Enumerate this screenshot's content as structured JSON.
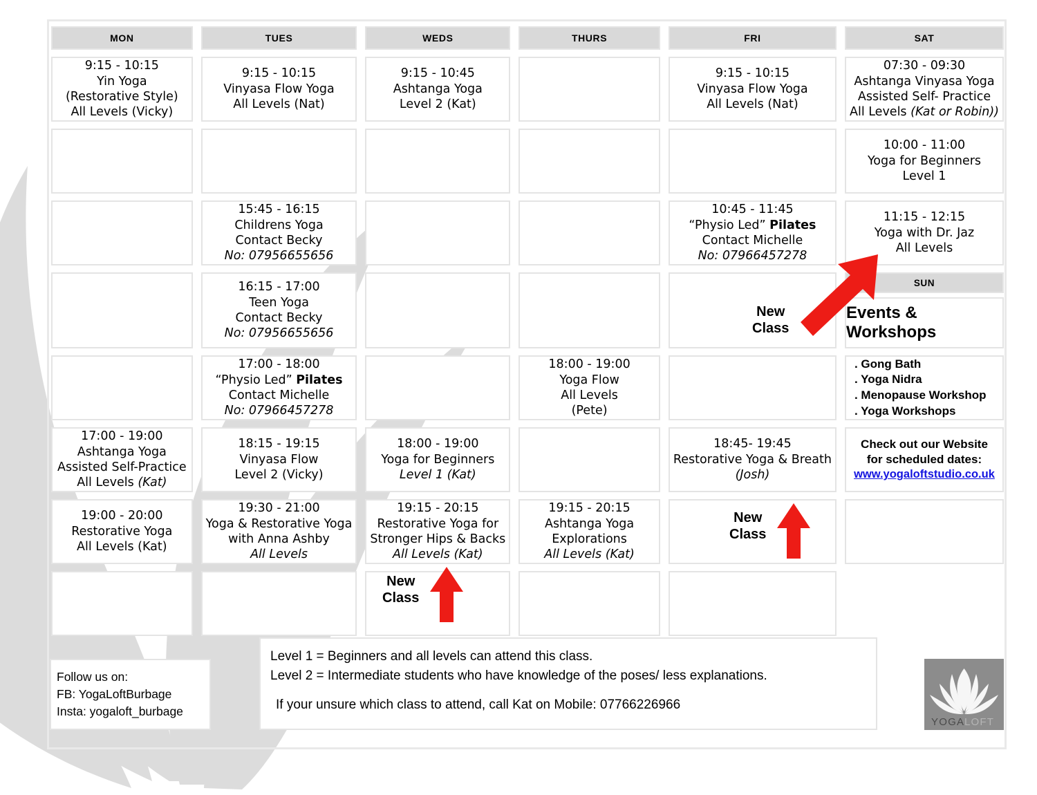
{
  "columns": [
    {
      "day": "MON",
      "cells": [
        {
          "lines": [
            {
              "t": "9:15 - 10:15"
            },
            {
              "t": "Yin Yoga"
            },
            {
              "t": "(Restorative Style)"
            },
            {
              "t": "All Levels (Vicky)"
            }
          ]
        },
        {
          "lines": []
        },
        {
          "lines": []
        },
        {
          "lines": []
        },
        {
          "lines": []
        },
        {
          "lines": [
            {
              "t": "17:00 - 19:00"
            },
            {
              "t": "Ashtanga Yoga"
            },
            {
              "t": "Assisted Self-Practice"
            },
            {
              "t": "All Levels "
            },
            {
              "t": "(Kat)",
              "style": "italic",
              "inline": true
            }
          ]
        },
        {
          "lines": [
            {
              "t": "19:00 - 20:00"
            },
            {
              "t": "Restorative Yoga"
            },
            {
              "t": "All Levels (Kat)"
            }
          ]
        },
        {
          "lines": []
        }
      ]
    },
    {
      "day": "TUES",
      "cells": [
        {
          "lines": [
            {
              "t": "9:15 - 10:15"
            },
            {
              "t": "Vinyasa Flow Yoga"
            },
            {
              "t": "All Levels (Nat)"
            }
          ]
        },
        {
          "lines": []
        },
        {
          "lines": [
            {
              "t": "15:45 - 16:15"
            },
            {
              "t": "Childrens Yoga"
            },
            {
              "t": "Contact Becky"
            },
            {
              "t": "No: 07956655656",
              "style": "italic"
            }
          ]
        },
        {
          "lines": [
            {
              "t": "16:15 - 17:00"
            },
            {
              "t": "Teen Yoga"
            },
            {
              "t": "Contact Becky"
            },
            {
              "t": "No: 07956655656",
              "style": "italic"
            }
          ]
        },
        {
          "lines": [
            {
              "t": "17:00 - 18:00"
            },
            {
              "t": "“Physio Led” ",
              "bold_tail": "Pilates"
            },
            {
              "t": "Contact Michelle"
            },
            {
              "t": "No: 07966457278",
              "style": "italic"
            }
          ]
        },
        {
          "lines": [
            {
              "t": "18:15 - 19:15"
            },
            {
              "t": "Vinyasa Flow"
            },
            {
              "t": "Level 2 (Vicky)"
            }
          ]
        },
        {
          "lines": [
            {
              "t": "19:30 - 21:00"
            },
            {
              "t": "Yoga & Restorative Yoga"
            },
            {
              "t": "with Anna Ashby"
            },
            {
              "t": "All Levels",
              "style": "italic"
            }
          ]
        },
        {
          "lines": []
        }
      ]
    },
    {
      "day": "WEDS",
      "cells": [
        {
          "lines": [
            {
              "t": "9:15 - 10:45"
            },
            {
              "t": "Ashtanga Yoga"
            },
            {
              "t": "Level 2 (Kat)"
            }
          ]
        },
        {
          "lines": []
        },
        {
          "lines": []
        },
        {
          "lines": []
        },
        {
          "lines": []
        },
        {
          "lines": [
            {
              "t": "18:00 - 19:00"
            },
            {
              "t": "Yoga for Beginners"
            },
            {
              "t": "Level 1 (Kat)",
              "style": "italic"
            }
          ]
        },
        {
          "lines": [
            {
              "t": "19:15 - 20:15"
            },
            {
              "t": "Restorative Yoga for"
            },
            {
              "t": "Stronger Hips & Backs"
            },
            {
              "t": "All Levels (Kat)",
              "style": "italic"
            }
          ]
        },
        {
          "lines": []
        }
      ]
    },
    {
      "day": "THURS",
      "cells": [
        {
          "lines": []
        },
        {
          "lines": []
        },
        {
          "lines": []
        },
        {
          "lines": []
        },
        {
          "lines": [
            {
              "t": "18:00 - 19:00"
            },
            {
              "t": "Yoga Flow"
            },
            {
              "t": "All Levels"
            },
            {
              "t": "(Pete)"
            }
          ]
        },
        {
          "lines": []
        },
        {
          "lines": [
            {
              "t": "19:15 - 20:15"
            },
            {
              "t": "Ashtanga Yoga"
            },
            {
              "t": "Explorations"
            },
            {
              "t": "All Levels (Kat)",
              "style": "italic"
            }
          ]
        },
        {
          "lines": []
        }
      ]
    },
    {
      "day": "FRI",
      "cells": [
        {
          "lines": [
            {
              "t": "9:15 - 10:15"
            },
            {
              "t": "Vinyasa Flow Yoga"
            },
            {
              "t": "All Levels (Nat)"
            }
          ]
        },
        {
          "lines": []
        },
        {
          "lines": [
            {
              "t": "10:45 - 11:45"
            },
            {
              "t": "“Physio Led” ",
              "bold_tail": "Pilates"
            },
            {
              "t": "Contact Michelle"
            },
            {
              "t": "No: 07966457278",
              "style": "italic"
            }
          ]
        },
        {
          "lines": []
        },
        {
          "lines": []
        },
        {
          "lines": [
            {
              "t": "18:45- 19:45"
            },
            {
              "t": "Restorative Yoga & Breath"
            },
            {
              "t": "(Josh)",
              "style": "italic"
            }
          ]
        },
        {
          "lines": []
        },
        {
          "lines": []
        }
      ]
    },
    {
      "day": "SAT",
      "cells": [
        {
          "lines": [
            {
              "t": "07:30 - 09:30"
            },
            {
              "t": "Ashtanga Vinyasa Yoga"
            },
            {
              "t": "Assisted Self- Practice"
            },
            {
              "t": "All Levels ",
              "italic_tail": "(Kat or Robin))"
            }
          ]
        },
        {
          "lines": [
            {
              "t": "10:00 - 11:00"
            },
            {
              "t": "Yoga for Beginners"
            },
            {
              "t": "Level 1"
            }
          ]
        },
        {
          "lines": [
            {
              "t": "11:15 - 12:15"
            },
            {
              "t": "Yoga with Dr. Jaz"
            },
            {
              "t": "All Levels"
            }
          ]
        }
      ]
    }
  ],
  "sunday": {
    "header": "SUN",
    "events_title": "Events & Workshops",
    "events": [
      ". Gong Bath",
      ". Yoga Nidra",
      ". Menopause Workshop",
      ". Yoga Workshops"
    ],
    "website_line1": "Check out our Website",
    "website_line2": "for scheduled dates:",
    "website_url": "www.yogaloftstudio.co.uk"
  },
  "annotations": {
    "new_class_line1": "New",
    "new_class_line2": "Class",
    "arrow_color": "#ed1c16"
  },
  "follow": {
    "line1": "Follow us on:",
    "line2": "FB: YogaLoftBurbage",
    "line3": "Insta: yogaloft_burbage"
  },
  "notes": {
    "level1": "Level 1 = Beginners and all levels can attend this class.",
    "level2": "Level 2 = Intermediate students who have knowledge of the poses/ less explanations.",
    "contact": "If your unsure which class to attend, call Kat on Mobile: 07766226966"
  },
  "logo": {
    "text_dark": "YOGA",
    "text_light": "LOFT",
    "bg_color": "#8c8c8c"
  }
}
